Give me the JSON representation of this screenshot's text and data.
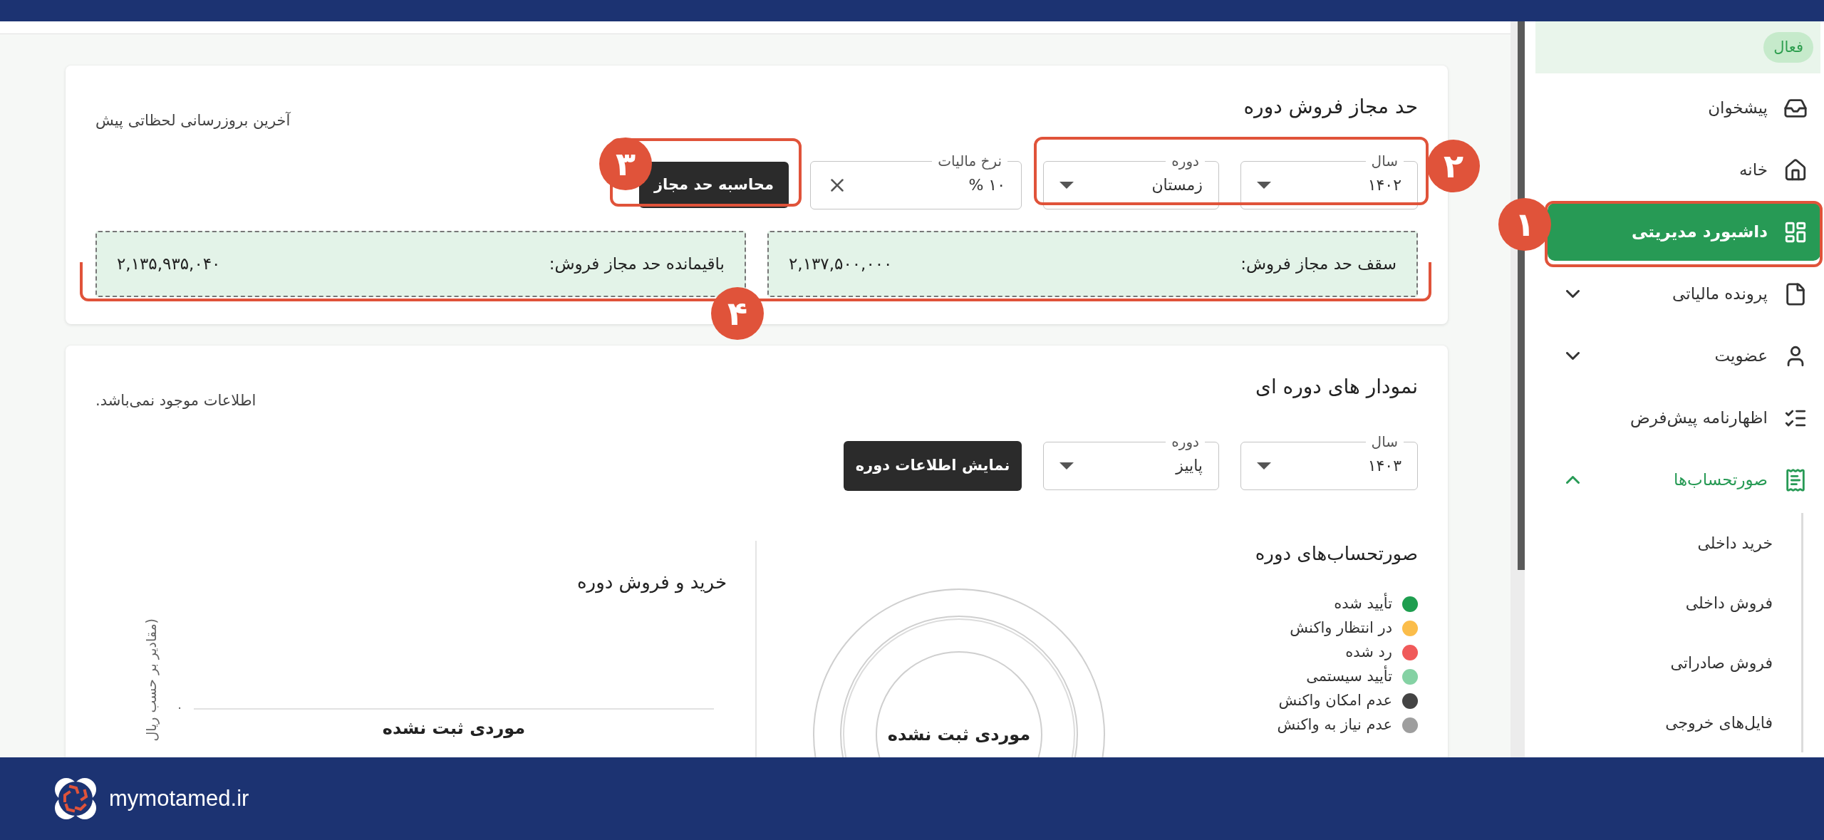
{
  "sidebar": {
    "status_badge": "فعال",
    "items": [
      {
        "label": "پیشخوان",
        "selected": false
      },
      {
        "label": "خانه",
        "selected": false
      },
      {
        "label": "داشبورد مدیریتی",
        "selected": true
      },
      {
        "label": "پرونده مالیاتی",
        "selected": false,
        "expanded": false
      },
      {
        "label": "عضویت",
        "selected": false,
        "expanded": false
      },
      {
        "label": "اظهارنامه پیش‌فرض",
        "selected": false
      },
      {
        "label": "صورتحساب‌ها",
        "selected": false,
        "expanded": true,
        "children": [
          {
            "label": "خرید داخلی",
            "selected": false
          },
          {
            "label": "فروش داخلی",
            "selected": false
          },
          {
            "label": "فروش صادراتی",
            "selected": false
          },
          {
            "label": "فایل‌های خروجی",
            "selected": false
          }
        ]
      }
    ]
  },
  "sales_limit_card": {
    "title": "حد مجاز فروش دوره",
    "update_note": "آخرین بروزرسانی لحظاتی پیش",
    "year_select": {
      "label": "سال",
      "value": "۱۴۰۲"
    },
    "period_select": {
      "label": "دوره",
      "value": "زمستان"
    },
    "tax_rate": {
      "label": "نرخ مالیات",
      "value": "۱۰ %"
    },
    "calculate_button": "محاسبه حد مجاز",
    "summaries": [
      {
        "label": "سقف حد مجاز فروش:",
        "value": "۲,۱۳۷,۵۰۰,۰۰۰"
      },
      {
        "label": "باقیمانده حد مجاز فروش:",
        "value": "۲,۱۳۵,۹۳۵,۰۴۰"
      }
    ]
  },
  "period_charts_card": {
    "title": "نمودار های دوره ای",
    "note": "اطلاعات موجود نمی‌باشد.",
    "year_select": {
      "label": "سال",
      "value": "۱۴۰۳"
    },
    "period_select": {
      "label": "دوره",
      "value": "پاییز"
    },
    "show_button": "نمایش اطلاعات دوره",
    "invoices_panel": {
      "title": "صورتحساب‌های دوره",
      "legend": [
        {
          "label": "تأیید شده",
          "color": "#1e9e4f"
        },
        {
          "label": "در انتظار واکنش",
          "color": "#fbbd4a"
        },
        {
          "label": "رد شده",
          "color": "#f05a5a"
        },
        {
          "label": "تأیید سیستمی",
          "color": "#85d2a4"
        },
        {
          "label": "عدم امکان واکنش",
          "color": "#444444"
        },
        {
          "label": "عدم نیاز به واکنش",
          "color": "#9e9e9e"
        }
      ],
      "empty_message": "موردی ثبت نشده"
    },
    "trade_panel": {
      "title": "خرید و فروش دوره",
      "ylabel": "(مقادیر بر حسب ریال",
      "ytick": "۰",
      "empty_message": "موردی ثبت نشده"
    }
  },
  "annotations": [
    {
      "label": "۱"
    },
    {
      "label": "۲"
    },
    {
      "label": "۳"
    },
    {
      "label": "۴"
    }
  ],
  "footer": {
    "site": "mymotamed.ir"
  }
}
